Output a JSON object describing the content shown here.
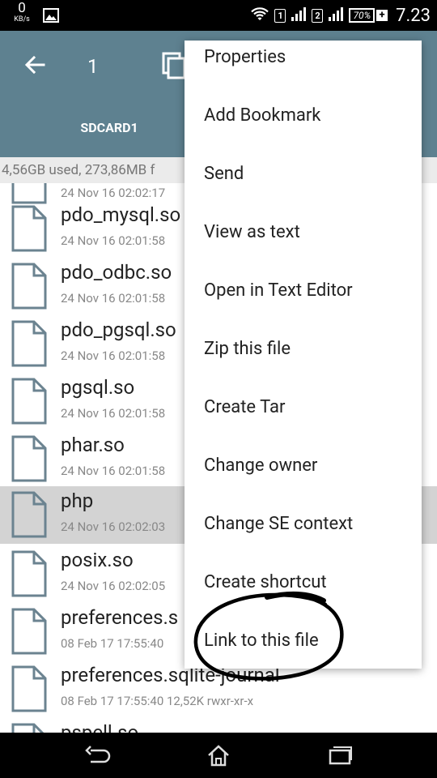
{
  "status_bar": {
    "net_speed_value": "0",
    "net_speed_unit": "KB/s",
    "sim1": "1",
    "sim2": "2",
    "battery": "70%",
    "battery_charge": "+",
    "time": "7.23"
  },
  "toolbar": {
    "selected_count": "1",
    "tab_label": "SDCARD1",
    "accent_color": "#5e8190"
  },
  "storage_info": "4,56GB used, 273,86MB f",
  "files": [
    {
      "name": "",
      "meta": "24 Nov 16 02:02:17"
    },
    {
      "name": "pdo_mysql.so",
      "meta": "24 Nov 16 02:01:58"
    },
    {
      "name": "pdo_odbc.so",
      "meta": "24 Nov 16 02:01:58"
    },
    {
      "name": "pdo_pgsql.so",
      "meta": "24 Nov 16 02:01:58"
    },
    {
      "name": "pgsql.so",
      "meta": "24 Nov 16 02:01:58"
    },
    {
      "name": "phar.so",
      "meta": "24 Nov 16 02:01:58"
    },
    {
      "name": "php",
      "meta": "24 Nov 16 02:02:03"
    },
    {
      "name": "posix.so",
      "meta": "24 Nov 16 02:02:05"
    },
    {
      "name": "preferences.s",
      "meta": "08 Feb 17 17:55:40"
    },
    {
      "name": "preferences.sqlite-journal",
      "meta": "08 Feb 17 17:55:40   12,52K   rwxr-xr-x"
    },
    {
      "name": "pspell.so",
      "meta": ""
    }
  ],
  "context_menu": [
    "Properties",
    "Add Bookmark",
    "Send",
    "View as text",
    "Open in Text Editor",
    "Zip this file",
    "Create Tar",
    "Change owner",
    "Change SE context",
    "Create shortcut",
    "Link to this file"
  ],
  "icons": {
    "back": "arrow-back-icon",
    "copy": "copy-icon",
    "file": "file-icon",
    "nav_back": "nav-back-icon",
    "nav_home": "nav-home-icon",
    "nav_recents": "nav-recents-icon"
  }
}
